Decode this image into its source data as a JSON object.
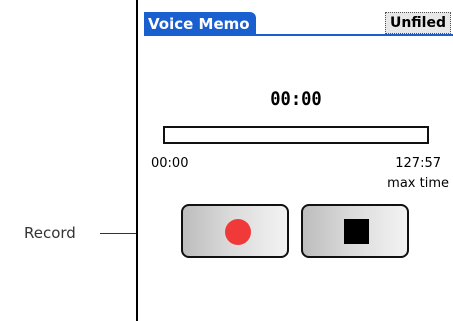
{
  "app": {
    "title": "Voice Memo",
    "category": "Unfiled"
  },
  "recorder": {
    "current_time": "00:00",
    "progress_fraction": 0,
    "start_time": "00:00",
    "end_time": "127:57",
    "max_time_label": "max time"
  },
  "controls": {
    "record_icon": "record-dot-icon",
    "stop_icon": "stop-square-icon",
    "record_color": "#f03a3a"
  },
  "annotation": {
    "record_label": "Record"
  },
  "colors": {
    "title_bar": "#1a5fd0"
  }
}
